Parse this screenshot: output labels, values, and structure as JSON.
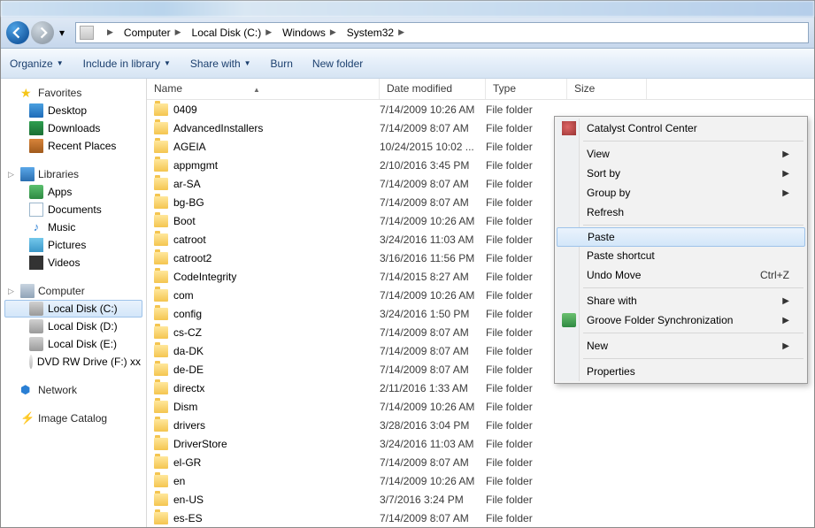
{
  "breadcrumb": [
    "Computer",
    "Local Disk (C:)",
    "Windows",
    "System32"
  ],
  "toolbar": {
    "organize": "Organize",
    "include": "Include in library",
    "share": "Share with",
    "burn": "Burn",
    "newfolder": "New folder"
  },
  "columns": {
    "name": "Name",
    "date": "Date modified",
    "type": "Type",
    "size": "Size"
  },
  "sidebar": {
    "favorites": {
      "label": "Favorites",
      "items": [
        "Desktop",
        "Downloads",
        "Recent Places"
      ]
    },
    "libraries": {
      "label": "Libraries",
      "items": [
        "Apps",
        "Documents",
        "Music",
        "Pictures",
        "Videos"
      ]
    },
    "computer": {
      "label": "Computer",
      "items": [
        "Local Disk (C:)",
        "Local Disk (D:)",
        "Local Disk (E:)",
        "DVD RW Drive (F:) xx"
      ]
    },
    "network": {
      "label": "Network"
    },
    "imagecatalog": {
      "label": "Image Catalog"
    }
  },
  "files": [
    {
      "name": "0409",
      "date": "7/14/2009 10:26 AM",
      "type": "File folder"
    },
    {
      "name": "AdvancedInstallers",
      "date": "7/14/2009 8:07 AM",
      "type": "File folder"
    },
    {
      "name": "AGEIA",
      "date": "10/24/2015 10:02 ...",
      "type": "File folder"
    },
    {
      "name": "appmgmt",
      "date": "2/10/2016 3:45 PM",
      "type": "File folder"
    },
    {
      "name": "ar-SA",
      "date": "7/14/2009 8:07 AM",
      "type": "File folder"
    },
    {
      "name": "bg-BG",
      "date": "7/14/2009 8:07 AM",
      "type": "File folder"
    },
    {
      "name": "Boot",
      "date": "7/14/2009 10:26 AM",
      "type": "File folder"
    },
    {
      "name": "catroot",
      "date": "3/24/2016 11:03 AM",
      "type": "File folder"
    },
    {
      "name": "catroot2",
      "date": "3/16/2016 11:56 PM",
      "type": "File folder"
    },
    {
      "name": "CodeIntegrity",
      "date": "7/14/2015 8:27 AM",
      "type": "File folder"
    },
    {
      "name": "com",
      "date": "7/14/2009 10:26 AM",
      "type": "File folder"
    },
    {
      "name": "config",
      "date": "3/24/2016 1:50 PM",
      "type": "File folder"
    },
    {
      "name": "cs-CZ",
      "date": "7/14/2009 8:07 AM",
      "type": "File folder"
    },
    {
      "name": "da-DK",
      "date": "7/14/2009 8:07 AM",
      "type": "File folder"
    },
    {
      "name": "de-DE",
      "date": "7/14/2009 8:07 AM",
      "type": "File folder"
    },
    {
      "name": "directx",
      "date": "2/11/2016 1:33 AM",
      "type": "File folder"
    },
    {
      "name": "Dism",
      "date": "7/14/2009 10:26 AM",
      "type": "File folder"
    },
    {
      "name": "drivers",
      "date": "3/28/2016 3:04 PM",
      "type": "File folder"
    },
    {
      "name": "DriverStore",
      "date": "3/24/2016 11:03 AM",
      "type": "File folder"
    },
    {
      "name": "el-GR",
      "date": "7/14/2009 8:07 AM",
      "type": "File folder"
    },
    {
      "name": "en",
      "date": "7/14/2009 10:26 AM",
      "type": "File folder"
    },
    {
      "name": "en-US",
      "date": "3/7/2016 3:24 PM",
      "type": "File folder"
    },
    {
      "name": "es-ES",
      "date": "7/14/2009 8:07 AM",
      "type": "File folder"
    }
  ],
  "contextmenu": {
    "catalyst": "Catalyst Control Center",
    "view": "View",
    "sortby": "Sort by",
    "groupby": "Group by",
    "refresh": "Refresh",
    "paste": "Paste",
    "pasteshortcut": "Paste shortcut",
    "undomove": "Undo Move",
    "undomove_key": "Ctrl+Z",
    "sharewith": "Share with",
    "groove": "Groove Folder Synchronization",
    "new": "New",
    "properties": "Properties"
  }
}
